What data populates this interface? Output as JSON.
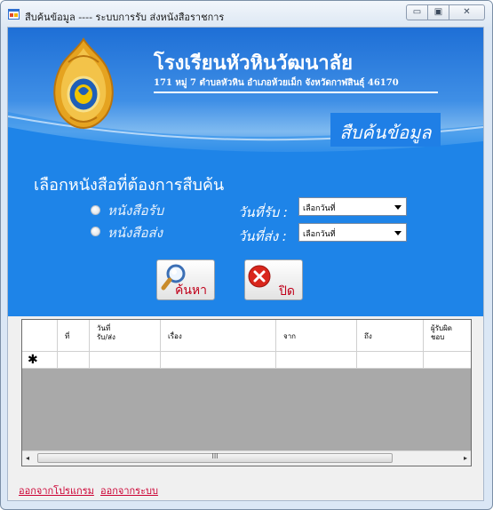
{
  "window": {
    "title": "สืบค้นข้อมูล ---- ระบบการรับ ส่งหนังสือราชการ",
    "minimize_glyph": "▭",
    "maximize_glyph": "▣",
    "close_glyph": "✕"
  },
  "header": {
    "school_name": "โรงเรียนหัวหินวัฒนาลัย",
    "address": "171 หมู่ 7   ตำบลหัวหิน  อำเภอห้วยเม็ก จังหวัดกาฬสินธุ์ 46170",
    "section_title": "สืบค้นข้อมูล",
    "colors": {
      "accent": "#1e84e8",
      "title_text": "#ffffff"
    }
  },
  "search": {
    "choose_label": "เลือกหนังสือที่ต้องการสืบค้น",
    "options": [
      {
        "label": "หนังสือรับ"
      },
      {
        "label": "หนังสือส่ง"
      }
    ],
    "received_date_label": "วันที่รับ :",
    "sent_date_label": "วันที่ส่ง :",
    "received_date_value": "เลือกวันที่",
    "sent_date_value": "เลือกวันที่"
  },
  "buttons": {
    "search_label": "ค้นหา",
    "search_icon": "magnifier-icon",
    "close_label": "ปิด",
    "close_icon": "close-x-icon"
  },
  "table": {
    "columns": [
      {
        "label": "ที่"
      },
      {
        "label": "วันที่\nรับ/ส่ง"
      },
      {
        "label": "เรื่อง"
      },
      {
        "label": "จาก"
      },
      {
        "label": "ถึง"
      },
      {
        "label": "ผู้รับผิด\nชอบ"
      }
    ],
    "new_row_marker": "✱",
    "scroll_left": "◂",
    "scroll_right": "▸",
    "scroll_grip": "III"
  },
  "footer": {
    "exit_program": "ออกจากโปรแกรม",
    "logout": "ออกจากระบบ"
  }
}
